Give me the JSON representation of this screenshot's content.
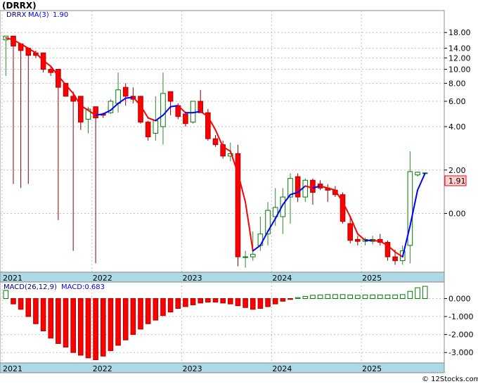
{
  "header": {
    "title": "(DRRX)"
  },
  "price_legend": {
    "symbol": "DRRX",
    "ma_label": "MA(3)",
    "ma_value": "1.90"
  },
  "price_badge": "1.91",
  "macd_legend": {
    "label": "MACD(26,12,9)",
    "value_label": "MACD:0.683"
  },
  "footer": "© 12Stocks.com",
  "colors": {
    "up": "#ffffff",
    "up_border": "#007a00",
    "down": "#ff0000",
    "down_border": "#b00000",
    "wick_up": "#2e8b2e",
    "wick_down": "#8b0000",
    "ma": "#0000ff",
    "ma_down": "#ff0000",
    "axis_band": "#add8e6",
    "badge_bg": "#ffd0d0",
    "badge_border": "#ff0000"
  },
  "chart_data": [
    {
      "type": "candlestick",
      "scale": "log",
      "yticks": [
        "18.00",
        "14.00",
        "12.00",
        "10.00",
        "8.00",
        "6.00",
        "4.00",
        "2.00",
        "0.00"
      ],
      "ytick_values": [
        18,
        14,
        12,
        10,
        8,
        6,
        4,
        2,
        1.0
      ],
      "xticks": [
        "2021",
        "2022",
        "2023",
        "2024",
        "2025"
      ],
      "xtick_index": [
        0,
        12,
        24,
        36,
        48
      ],
      "ylim": [
        0.4,
        25
      ],
      "candles": [
        {
          "o": 16.0,
          "h": 17.0,
          "l": 9.0,
          "c": 17.0
        },
        {
          "o": 17.0,
          "h": 17.0,
          "l": 1.6,
          "c": 14.5
        },
        {
          "o": 15.0,
          "h": 15.0,
          "l": 1.5,
          "c": 13.5
        },
        {
          "o": 14.0,
          "h": 14.0,
          "l": 1.6,
          "c": 12.5
        },
        {
          "o": 13.0,
          "h": 13.5,
          "l": 12.0,
          "c": 12.5
        },
        {
          "o": 13.0,
          "h": 13.0,
          "l": 9.5,
          "c": 10.0
        },
        {
          "o": 10.0,
          "h": 10.5,
          "l": 9.0,
          "c": 9.5
        },
        {
          "o": 10.0,
          "h": 10.0,
          "l": 0.9,
          "c": 7.5
        },
        {
          "o": 8.0,
          "h": 8.0,
          "l": 6.5,
          "c": 6.5
        },
        {
          "o": 6.5,
          "h": 7.0,
          "l": 0.55,
          "c": 6.0
        },
        {
          "o": 6.5,
          "h": 6.5,
          "l": 3.8,
          "c": 4.3
        },
        {
          "o": 4.5,
          "h": 5.5,
          "l": 3.6,
          "c": 5.3
        },
        {
          "o": 5.5,
          "h": 5.5,
          "l": 0.45,
          "c": 4.6
        },
        {
          "o": 4.9,
          "h": 5.0,
          "l": 4.6,
          "c": 4.8
        },
        {
          "o": 5.0,
          "h": 6.2,
          "l": 4.9,
          "c": 6.0
        },
        {
          "o": 5.8,
          "h": 9.5,
          "l": 5.0,
          "c": 7.2
        },
        {
          "o": 7.5,
          "h": 8.0,
          "l": 5.6,
          "c": 6.5
        },
        {
          "o": 6.5,
          "h": 7.5,
          "l": 5.8,
          "c": 6.2
        },
        {
          "o": 6.5,
          "h": 6.5,
          "l": 4.2,
          "c": 4.3
        },
        {
          "o": 4.3,
          "h": 4.4,
          "l": 3.2,
          "c": 3.4
        },
        {
          "o": 3.6,
          "h": 6.5,
          "l": 3.2,
          "c": 4.4
        },
        {
          "o": 4.0,
          "h": 9.5,
          "l": 3.0,
          "c": 6.8
        },
        {
          "o": 7.0,
          "h": 7.0,
          "l": 4.8,
          "c": 6.0
        },
        {
          "o": 5.6,
          "h": 5.8,
          "l": 4.5,
          "c": 4.7
        },
        {
          "o": 4.9,
          "h": 4.9,
          "l": 4.0,
          "c": 4.2
        },
        {
          "o": 4.3,
          "h": 6.0,
          "l": 4.2,
          "c": 6.0
        },
        {
          "o": 6.0,
          "h": 7.2,
          "l": 5.0,
          "c": 5.0
        },
        {
          "o": 5.0,
          "h": 5.3,
          "l": 3.2,
          "c": 3.3
        },
        {
          "o": 3.3,
          "h": 3.5,
          "l": 2.9,
          "c": 3.0
        },
        {
          "o": 3.0,
          "h": 3.2,
          "l": 2.4,
          "c": 2.5
        },
        {
          "o": 2.5,
          "h": 3.1,
          "l": 2.3,
          "c": 2.6
        },
        {
          "o": 2.6,
          "h": 3.0,
          "l": 0.43,
          "c": 0.5
        },
        {
          "o": 0.5,
          "h": 0.55,
          "l": 0.42,
          "c": 0.5
        },
        {
          "o": 0.5,
          "h": 0.75,
          "l": 0.47,
          "c": 0.52
        },
        {
          "o": 0.6,
          "h": 0.95,
          "l": 0.55,
          "c": 0.72
        },
        {
          "o": 0.72,
          "h": 1.2,
          "l": 0.6,
          "c": 1.05
        },
        {
          "o": 0.95,
          "h": 1.5,
          "l": 0.82,
          "c": 1.1
        },
        {
          "o": 0.95,
          "h": 1.5,
          "l": 0.72,
          "c": 1.3
        },
        {
          "o": 1.3,
          "h": 1.9,
          "l": 0.85,
          "c": 1.75
        },
        {
          "o": 1.8,
          "h": 1.9,
          "l": 1.2,
          "c": 1.3
        },
        {
          "o": 1.3,
          "h": 1.75,
          "l": 1.2,
          "c": 1.7
        },
        {
          "o": 1.7,
          "h": 1.75,
          "l": 1.15,
          "c": 1.4
        },
        {
          "o": 1.6,
          "h": 1.7,
          "l": 1.45,
          "c": 1.5
        },
        {
          "o": 1.5,
          "h": 1.6,
          "l": 1.2,
          "c": 1.45
        },
        {
          "o": 1.45,
          "h": 1.55,
          "l": 1.3,
          "c": 1.35
        },
        {
          "o": 1.35,
          "h": 1.4,
          "l": 0.85,
          "c": 0.88
        },
        {
          "o": 0.85,
          "h": 0.95,
          "l": 0.62,
          "c": 0.65
        },
        {
          "o": 0.66,
          "h": 0.7,
          "l": 0.6,
          "c": 0.64
        },
        {
          "o": 0.64,
          "h": 0.68,
          "l": 0.6,
          "c": 0.66
        },
        {
          "o": 0.64,
          "h": 0.7,
          "l": 0.61,
          "c": 0.66
        },
        {
          "o": 0.66,
          "h": 0.72,
          "l": 0.6,
          "c": 0.63
        },
        {
          "o": 0.63,
          "h": 0.65,
          "l": 0.47,
          "c": 0.5
        },
        {
          "o": 0.5,
          "h": 0.56,
          "l": 0.44,
          "c": 0.47
        },
        {
          "o": 0.47,
          "h": 0.6,
          "l": 0.44,
          "c": 0.55
        },
        {
          "o": 0.6,
          "h": 2.7,
          "l": 0.45,
          "c": 1.95
        },
        {
          "o": 1.85,
          "h": 1.95,
          "l": 1.8,
          "c": 1.93
        },
        {
          "o": 1.9,
          "h": 1.92,
          "l": 1.88,
          "c": 1.91
        }
      ],
      "ma3": [
        16.5,
        16.0,
        15.0,
        14.0,
        13.0,
        11.5,
        10.5,
        9.0,
        7.8,
        6.8,
        5.6,
        5.2,
        4.8,
        4.9,
        5.2,
        5.8,
        6.3,
        6.4,
        5.6,
        4.6,
        4.4,
        4.8,
        5.5,
        5.6,
        5.0,
        5.0,
        5.1,
        4.7,
        3.8,
        2.9,
        2.7,
        1.9,
        1.2,
        0.55,
        0.6,
        0.75,
        0.92,
        1.15,
        1.35,
        1.4,
        1.55,
        1.5,
        1.55,
        1.5,
        1.45,
        1.2,
        0.95,
        0.72,
        0.65,
        0.65,
        0.64,
        0.6,
        0.54,
        0.5,
        0.82,
        1.45,
        1.9
      ]
    },
    {
      "type": "bar",
      "name": "MACD(26,12,9)",
      "yticks": [
        "0.000",
        "-1.000",
        "-2.000",
        "-3.000"
      ],
      "ytick_values": [
        0,
        -1,
        -2,
        -3
      ],
      "ylim": [
        -3.5,
        0.8
      ],
      "values": [
        0.45,
        -0.3,
        -0.6,
        -1.0,
        -1.4,
        -1.8,
        -2.2,
        -2.5,
        -2.7,
        -3.0,
        -3.15,
        -3.3,
        -3.4,
        -3.2,
        -2.9,
        -2.6,
        -2.3,
        -2.0,
        -1.7,
        -1.4,
        -1.2,
        -0.95,
        -0.75,
        -0.55,
        -0.45,
        -0.35,
        -0.25,
        -0.2,
        -0.2,
        -0.25,
        -0.3,
        -0.4,
        -0.5,
        -0.6,
        -0.55,
        -0.45,
        -0.3,
        -0.15,
        -0.05,
        0.05,
        0.12,
        0.18,
        0.2,
        0.22,
        0.22,
        0.22,
        0.2,
        0.18,
        0.2,
        0.2,
        0.2,
        0.2,
        0.2,
        0.22,
        0.4,
        0.6,
        0.68
      ]
    }
  ]
}
